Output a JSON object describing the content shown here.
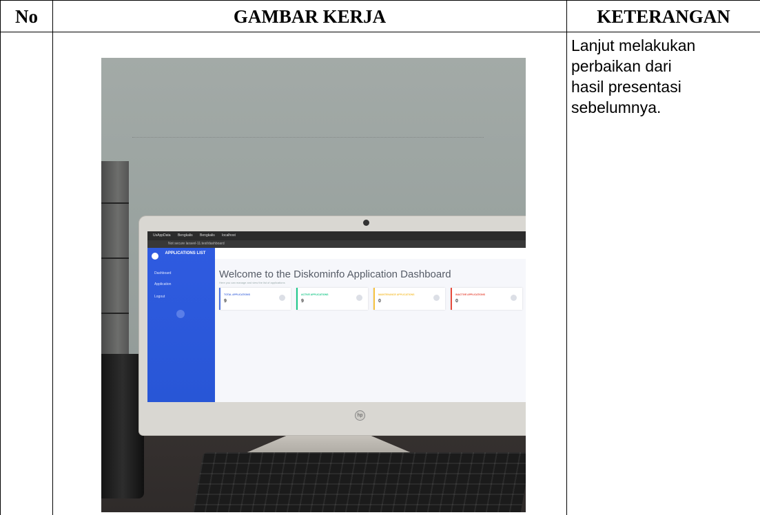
{
  "table": {
    "headers": {
      "no": "No",
      "gambar_kerja": "GAMBAR KERJA",
      "keterangan": "KETERANGAN"
    },
    "rows": [
      {
        "no": "",
        "keterangan_lines": [
          "Lanjut melakukan",
          "perbaikan dari",
          "hasil presentasi",
          "sebelumnya."
        ]
      }
    ]
  },
  "photo": {
    "screen": {
      "browser_tabs": [
        "UsAppData",
        "Bengkalis",
        "Bengkalis",
        "localhost"
      ],
      "address": "Not secure  laravel-11.test/dashboard",
      "brand": "APPLICATIONS LIST",
      "sidebar_items": [
        "Dashboard",
        "Application",
        "Logout"
      ],
      "welcome_title": "Welcome to the Diskominfo Application Dashboard",
      "welcome_subtitle": "Here you can manage and view the list of applications",
      "cards": [
        {
          "label": "TOTAL APPLICATIONS",
          "value": "9",
          "color": "#4e73df"
        },
        {
          "label": "ACTIVE APPLICATIONS",
          "value": "9",
          "color": "#1cc88a"
        },
        {
          "label": "MAINTENANCE APPLICATIONS",
          "value": "0",
          "color": "#f6c23e"
        },
        {
          "label": "INACTIVE APPLICATIONS",
          "value": "0",
          "color": "#e74a3b"
        }
      ],
      "hp_logo": "hp"
    }
  }
}
